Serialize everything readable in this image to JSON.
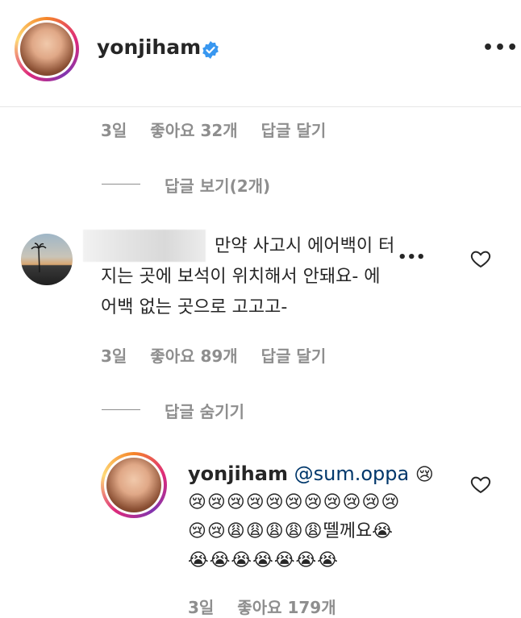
{
  "header": {
    "username": "yonjiham",
    "more": "•••"
  },
  "comment_meta_1": {
    "time": "3일",
    "likes": "좋아요 32개",
    "reply": "답글 달기"
  },
  "view_replies": "답글 보기(2개)",
  "comment2": {
    "text_line1": "만약 사고시 에어백이 터",
    "text_line2": "지는 곳에 보석이 위치해서 안돼요- 에",
    "text_line3": "어백 없는 곳으로 고고고-",
    "more": "•••",
    "meta": {
      "time": "3일",
      "likes": "좋아요 89개",
      "reply": "답글 달기"
    }
  },
  "hide_replies": "답글 숨기기",
  "reply1": {
    "username": "yonjiham",
    "mention": "@sum.oppa",
    "emoji_line1": "😢",
    "emoji_line2": "😢😢😢😢😢😢😢😢😢😢😢",
    "emoji_line3": "😢😢😩😩😩😩😩",
    "text_after_emoji": "뗄께요",
    "emoji_line3_end": "😭",
    "emoji_line4": "😭😭😭😭😭😭😭",
    "meta": {
      "time": "3일",
      "likes": "좋아요 179개"
    }
  },
  "colors": {
    "text": "#262626",
    "muted": "#8e8e8e",
    "mention": "#00376b",
    "verified": "#3897f0"
  }
}
